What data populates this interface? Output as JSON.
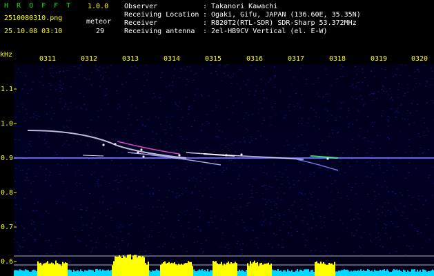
{
  "header": {
    "app_name": "H R O F F T",
    "version": "1.0.0",
    "filename": "2510080310.png",
    "detector_label": "meteor",
    "datetime": "25.10.08 03:10",
    "meteor_count": "29",
    "info_rows": [
      {
        "key": "Observer",
        "sep": ":",
        "value": "Takanori Kawachi"
      },
      {
        "key": "Receiving Location",
        "sep": ":",
        "value": "Ogaki, Gifu, JAPAN (136.60E, 35.35N)"
      },
      {
        "key": "Receiver",
        "sep": ":",
        "value": "R820T2(RTL-SDR) SDR-Sharp 53.372MHz"
      },
      {
        "key": "Receiving antenna",
        "sep": ":",
        "value": "2el-HB9CV Vertical (el. E-W)"
      }
    ]
  },
  "spectrogram": {
    "unit_label": "kHz",
    "time_ticks": [
      "0311",
      "0312",
      "0313",
      "0314",
      "0315",
      "0316",
      "0317",
      "0318",
      "0319",
      "0320"
    ],
    "freq_ticks": [
      "1.1",
      "1.0",
      "0.9",
      "0.8",
      "0.7",
      "0.6"
    ],
    "colors": {
      "background": "#000010",
      "carrier": "#8080ff",
      "echo": "#e0e0ff",
      "level_bar": "#00d8ff",
      "level_peak": "#ffff00"
    }
  }
}
